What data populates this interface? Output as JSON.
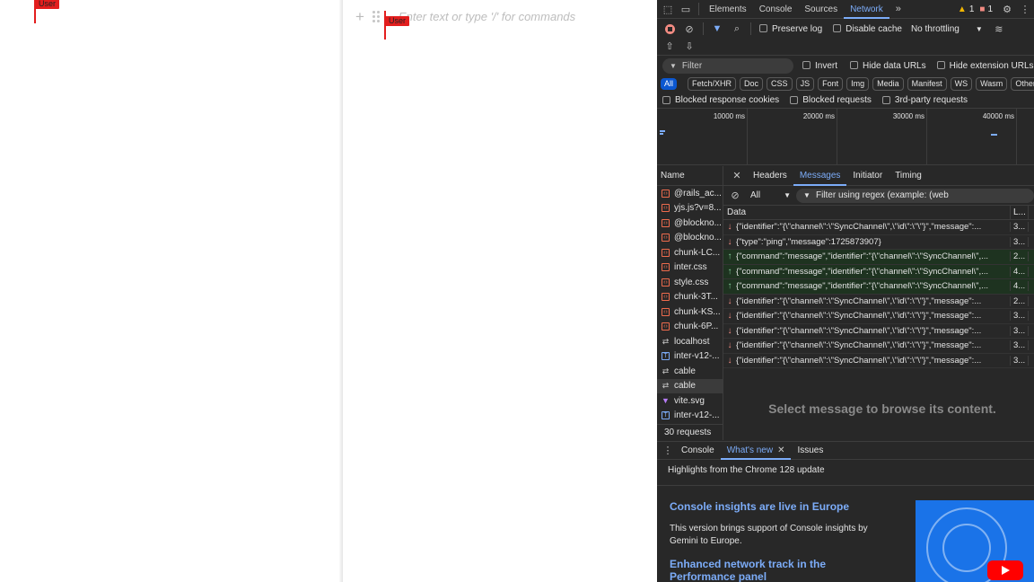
{
  "cursor_labels": [
    "User",
    "User"
  ],
  "editor": {
    "placeholder": "Enter text or type '/' for commands"
  },
  "devtools": {
    "tabs": [
      "Elements",
      "Console",
      "Sources",
      "Network"
    ],
    "active_tab": "Network",
    "warnings_count": "1",
    "errors_count": "1",
    "toolbar": {
      "preserve_log": "Preserve log",
      "disable_cache": "Disable cache",
      "throttling": "No throttling"
    },
    "filter": {
      "placeholder": "Filter",
      "invert": "Invert",
      "hide_data_urls": "Hide data URLs",
      "hide_extension_urls": "Hide extension URLs"
    },
    "types": [
      "All",
      "Fetch/XHR",
      "Doc",
      "CSS",
      "JS",
      "Font",
      "Img",
      "Media",
      "Manifest",
      "WS",
      "Wasm",
      "Other"
    ],
    "blocked": {
      "blocked_response_cookies": "Blocked response cookies",
      "blocked_requests": "Blocked requests",
      "third_party_requests": "3rd-party requests"
    },
    "timeline_ticks": [
      "10000 ms",
      "20000 ms",
      "30000 ms",
      "40000 ms"
    ],
    "requests_header": "Name",
    "requests": [
      {
        "name": "@rails_ac...",
        "type": "js"
      },
      {
        "name": "yjs.js?v=8...",
        "type": "js"
      },
      {
        "name": "@blockno...",
        "type": "js"
      },
      {
        "name": "@blockno...",
        "type": "js"
      },
      {
        "name": "chunk-LC...",
        "type": "js"
      },
      {
        "name": "inter.css",
        "type": "css"
      },
      {
        "name": "style.css",
        "type": "css"
      },
      {
        "name": "chunk-3T...",
        "type": "js"
      },
      {
        "name": "chunk-KS...",
        "type": "js"
      },
      {
        "name": "chunk-6P...",
        "type": "js"
      },
      {
        "name": "localhost",
        "type": "ws"
      },
      {
        "name": "inter-v12-...",
        "type": "font"
      },
      {
        "name": "cable",
        "type": "ws"
      },
      {
        "name": "cable",
        "type": "ws",
        "selected": true
      },
      {
        "name": "vite.svg",
        "type": "svg"
      },
      {
        "name": "inter-v12-...",
        "type": "font"
      }
    ],
    "requests_footer": "30 requests",
    "detail_tabs": [
      "Headers",
      "Messages",
      "Initiator",
      "Timing"
    ],
    "active_detail_tab": "Messages",
    "message_filter": {
      "type": "All",
      "regex_placeholder": "Filter using regex (example: (web"
    },
    "messages_columns": {
      "data": "Data",
      "length": "L..."
    },
    "messages": [
      {
        "dir": "recv",
        "data": "{\"identifier\":\"{\\\"channel\\\":\\\"SyncChannel\\\",\\\"id\\\":\\\"\\\"}\",\"message\":...",
        "len": "3..."
      },
      {
        "dir": "recv",
        "data": "{\"type\":\"ping\",\"message\":1725873907}",
        "len": "3..."
      },
      {
        "dir": "sent",
        "data": "{\"command\":\"message\",\"identifier\":\"{\\\"channel\\\":\\\"SyncChannel\\\",...",
        "len": "2..."
      },
      {
        "dir": "sent",
        "data": "{\"command\":\"message\",\"identifier\":\"{\\\"channel\\\":\\\"SyncChannel\\\",...",
        "len": "4..."
      },
      {
        "dir": "sent",
        "data": "{\"command\":\"message\",\"identifier\":\"{\\\"channel\\\":\\\"SyncChannel\\\",...",
        "len": "4..."
      },
      {
        "dir": "recv",
        "data": "{\"identifier\":\"{\\\"channel\\\":\\\"SyncChannel\\\",\\\"id\\\":\\\"\\\"}\",\"message\":...",
        "len": "2..."
      },
      {
        "dir": "recv",
        "data": "{\"identifier\":\"{\\\"channel\\\":\\\"SyncChannel\\\",\\\"id\\\":\\\"\\\"}\",\"message\":...",
        "len": "3..."
      },
      {
        "dir": "recv",
        "data": "{\"identifier\":\"{\\\"channel\\\":\\\"SyncChannel\\\",\\\"id\\\":\\\"\\\"}\",\"message\":...",
        "len": "3..."
      },
      {
        "dir": "recv",
        "data": "{\"identifier\":\"{\\\"channel\\\":\\\"SyncChannel\\\",\\\"id\\\":\\\"\\\"}\",\"message\":...",
        "len": "3..."
      },
      {
        "dir": "recv",
        "data": "{\"identifier\":\"{\\\"channel\\\":\\\"SyncChannel\\\",\\\"id\\\":\\\"\\\"}\",\"message\":...",
        "len": "3..."
      }
    ],
    "empty_message": "Select message to browse its content.",
    "drawer": {
      "tabs": [
        "Console",
        "What's new",
        "Issues"
      ],
      "active_tab": "What's new",
      "highlights": "Highlights from the Chrome 128 update",
      "item1_title": "Console insights are live in Europe",
      "item1_desc": "This version brings support of Console insights by Gemini to Europe.",
      "item2_title": "Enhanced network track in the Performance panel"
    }
  },
  "colors": {
    "accent": "#7cacf8",
    "cursor": "#e31e1e",
    "devtools_bg": "#282828"
  }
}
